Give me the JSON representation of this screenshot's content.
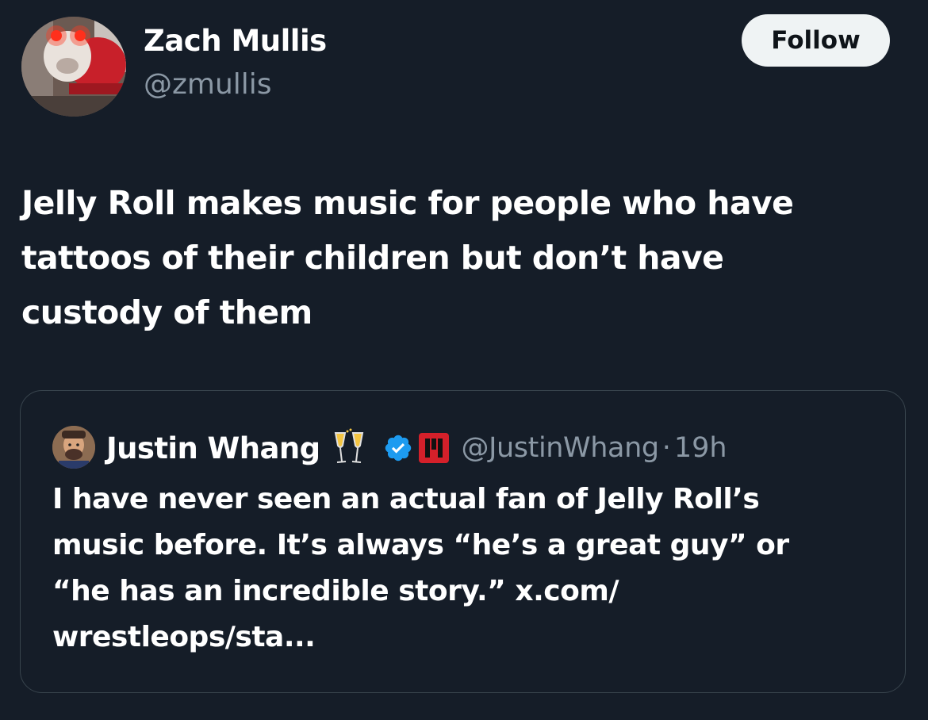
{
  "tweet": {
    "author": {
      "name": "Zach Mullis",
      "handle": "@zmullis"
    },
    "follow_label": "Follow",
    "text_lines": [
      "Jelly Roll makes music for people who have",
      "tattoos of their children but don’t have",
      "custody of them"
    ]
  },
  "quoted_tweet": {
    "author": {
      "name": "Justin Whang",
      "handle": "@JustinWhang",
      "separator": "·",
      "time": "19h"
    },
    "icons": [
      "clinking-glasses-emoji",
      "verified-badge-icon",
      "affiliate-badge-icon"
    ],
    "text_lines": [
      "I have never seen an actual fan of Jelly Roll’s",
      "music before. It’s always “he’s a great guy” or",
      "“he has an incredible story.” x.com/",
      "wrestleops/sta..."
    ]
  },
  "colors": {
    "background": "#151d28",
    "text": "#ffffff",
    "secondary_text": "#8b98a5",
    "border": "#38444d",
    "follow_button_bg": "#eff3f4",
    "verified_blue": "#1d9bf0"
  }
}
